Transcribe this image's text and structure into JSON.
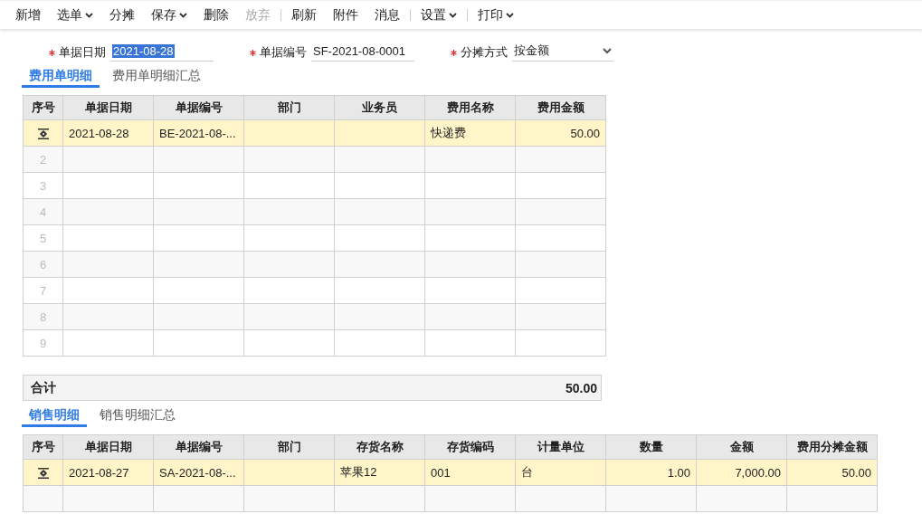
{
  "toolbar": [
    {
      "kind": "button",
      "label": "新增",
      "disabled": false,
      "dropdown": false
    },
    {
      "kind": "button",
      "label": "选单",
      "disabled": false,
      "dropdown": true
    },
    {
      "kind": "button",
      "label": "分摊",
      "disabled": false,
      "dropdown": false
    },
    {
      "kind": "button",
      "label": "保存",
      "disabled": false,
      "dropdown": true
    },
    {
      "kind": "button",
      "label": "删除",
      "disabled": false,
      "dropdown": false
    },
    {
      "kind": "button",
      "label": "放弃",
      "disabled": true,
      "dropdown": false
    },
    {
      "kind": "separator"
    },
    {
      "kind": "button",
      "label": "刷新",
      "disabled": false,
      "dropdown": false
    },
    {
      "kind": "button",
      "label": "附件",
      "disabled": false,
      "dropdown": false
    },
    {
      "kind": "button",
      "label": "消息",
      "disabled": false,
      "dropdown": false
    },
    {
      "kind": "separator"
    },
    {
      "kind": "button",
      "label": "设置",
      "disabled": false,
      "dropdown": true
    },
    {
      "kind": "separator"
    },
    {
      "kind": "button",
      "label": "打印",
      "disabled": false,
      "dropdown": true
    }
  ],
  "fields": [
    {
      "kind": "text",
      "label": "单据日期",
      "required": true,
      "value": "2021-08-28",
      "highlighted": true
    },
    {
      "kind": "text",
      "label": "单据编号",
      "required": true,
      "value": "SF-2021-08-0001",
      "highlighted": false
    },
    {
      "kind": "select",
      "label": "分摊方式",
      "required": true,
      "value": "按金额",
      "highlighted": false
    }
  ],
  "sections": [
    {
      "tabs": [
        {
          "label": "费用单明细",
          "selected": true
        },
        {
          "label": "费用单明细汇总",
          "selected": false
        }
      ],
      "table": {
        "columns": [
          "序号",
          "单据日期",
          "单据编号",
          "部门",
          "业务员",
          "费用名称",
          "费用金额"
        ],
        "rows": [
          {
            "selected": true,
            "index_icon": true,
            "cells": [
              "",
              "2021-08-28",
              "BE-2021-08-...",
              "",
              "",
              "快递费",
              "50.00"
            ]
          },
          {
            "selected": false,
            "index_icon": false,
            "cells": [
              "2",
              "",
              "",
              "",
              "",
              "",
              ""
            ]
          },
          {
            "selected": false,
            "index_icon": false,
            "cells": [
              "3",
              "",
              "",
              "",
              "",
              "",
              ""
            ]
          },
          {
            "selected": false,
            "index_icon": false,
            "cells": [
              "4",
              "",
              "",
              "",
              "",
              "",
              ""
            ]
          },
          {
            "selected": false,
            "index_icon": false,
            "cells": [
              "5",
              "",
              "",
              "",
              "",
              "",
              ""
            ]
          },
          {
            "selected": false,
            "index_icon": false,
            "cells": [
              "6",
              "",
              "",
              "",
              "",
              "",
              ""
            ]
          },
          {
            "selected": false,
            "index_icon": false,
            "cells": [
              "7",
              "",
              "",
              "",
              "",
              "",
              ""
            ]
          },
          {
            "selected": false,
            "index_icon": false,
            "cells": [
              "8",
              "",
              "",
              "",
              "",
              "",
              ""
            ]
          },
          {
            "selected": false,
            "index_icon": false,
            "cells": [
              "9",
              "",
              "",
              "",
              "",
              "",
              ""
            ]
          }
        ],
        "total": {
          "label": "合计",
          "value": "50.00"
        }
      }
    },
    {
      "tabs": [
        {
          "label": "销售明细",
          "selected": true
        },
        {
          "label": "销售明细汇总",
          "selected": false
        }
      ],
      "table": {
        "columns": [
          "序号",
          "单据日期",
          "单据编号",
          "部门",
          "存货名称",
          "存货编码",
          "计量单位",
          "数量",
          "金额",
          "费用分摊金额"
        ],
        "rows": [
          {
            "selected": true,
            "index_icon": true,
            "cells": [
              "",
              "2021-08-27",
              "SA-2021-08-...",
              "",
              "苹果12",
              "001",
              "台",
              "1.00",
              "7,000.00",
              "50.00"
            ]
          },
          {
            "selected": false,
            "index_icon": false,
            "cells": [
              "",
              "",
              "",
              "",
              "",
              "",
              "",
              "",
              "",
              ""
            ]
          }
        ]
      }
    }
  ]
}
